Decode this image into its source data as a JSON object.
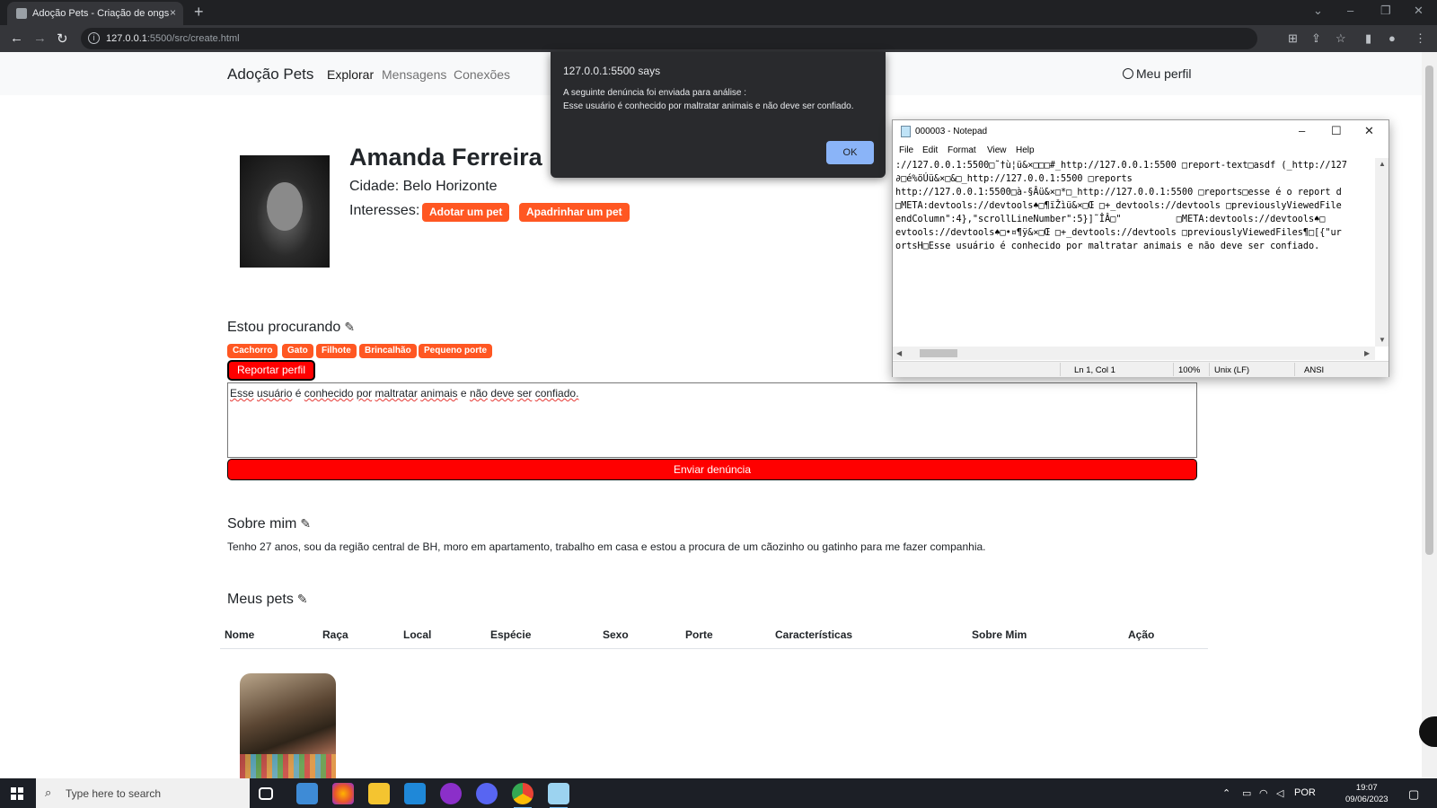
{
  "browser": {
    "tab_title": "Adoção Pets - Criação de ongs",
    "tab_close": "×",
    "new_tab": "+",
    "url_host": "127.0.0.1",
    "url_path": ":5500/src/create.html"
  },
  "site": {
    "brand": "Adoção Pets",
    "nav": [
      "Explorar",
      "Mensagens",
      "Conexões"
    ],
    "profile_link": "Meu perfil"
  },
  "profile": {
    "name": "Amanda Ferreira",
    "city": "Cidade: Belo Horizonte",
    "interests_label": "Interesses:",
    "interests": [
      "Adotar um pet",
      "Apadrinhar um pet"
    ]
  },
  "looking_for": {
    "heading": "Estou procurando",
    "tags": [
      "Cachorro",
      "Gato",
      "Filhote",
      "Brincalhão",
      "Pequeno porte"
    ]
  },
  "report": {
    "button": "Reportar perfil",
    "text_words": [
      "Esse",
      "usuário",
      "é",
      "conhecido",
      "por",
      "maltratar",
      "animais",
      "e",
      "não",
      "deve",
      "ser",
      "confiado."
    ],
    "submit": "Enviar denúncia"
  },
  "about": {
    "heading": "Sobre mim",
    "text": "Tenho 27 anos, sou da região central de BH, moro em apartamento, trabalho em casa e estou a procura de um cãozinho ou gatinho para me fazer companhia."
  },
  "pets": {
    "heading": "Meus pets",
    "columns": [
      "Nome",
      "Raça",
      "Local",
      "Espécie",
      "Sexo",
      "Porte",
      "Características",
      "Sobre Mim",
      "Ação"
    ]
  },
  "alert": {
    "title": "127.0.0.1:5500 says",
    "line1": "A seguinte denúncia foi enviada para análise :",
    "line2": "Esse usuário é conhecido por maltratar animais e não deve ser confiado.",
    "ok": "OK"
  },
  "notepad": {
    "title": "000003 - Notepad",
    "menu": [
      "File",
      "Edit",
      "Format",
      "View",
      "Help"
    ],
    "lines": [
      "://127.0.0.1:5500□˜†ù¦ü&×□□□#_http://127.0.0.1:5500 □report-text□asdf (_http://127",
      "∂□é%öÚü&×□&□_http://127.0.0.1:5500 □reports",
      "http://127.0.0.1:5500□à-§Âü&×□*□_http://127.0.0.1:5500 □reports□esse é o report d",
      "□META:devtools://devtools♠□¶ïŽìü&×□Œ □+_devtools://devtools □previouslyViewedFile",
      "endColumn\":4},\"scrollLineNumber\":5}]˜ÎÂ□\"          □META:devtools://devtools♠□",
      "evtools://devtools♠□•¤¶ÿ&×□Œ □+_devtools://devtools □previouslyViewedFiles¶□[{\"ur",
      "ortsH□Esse usuário é conhecido por maltratar animais e não deve ser confiado."
    ],
    "status": {
      "position": "Ln 1, Col 1",
      "zoom": "100%",
      "line_ending": "Unix (LF)",
      "encoding": "ANSI"
    }
  },
  "taskbar": {
    "search_placeholder": "Type here to search",
    "language": "POR",
    "time": "19:07",
    "date": "09/06/2023"
  }
}
